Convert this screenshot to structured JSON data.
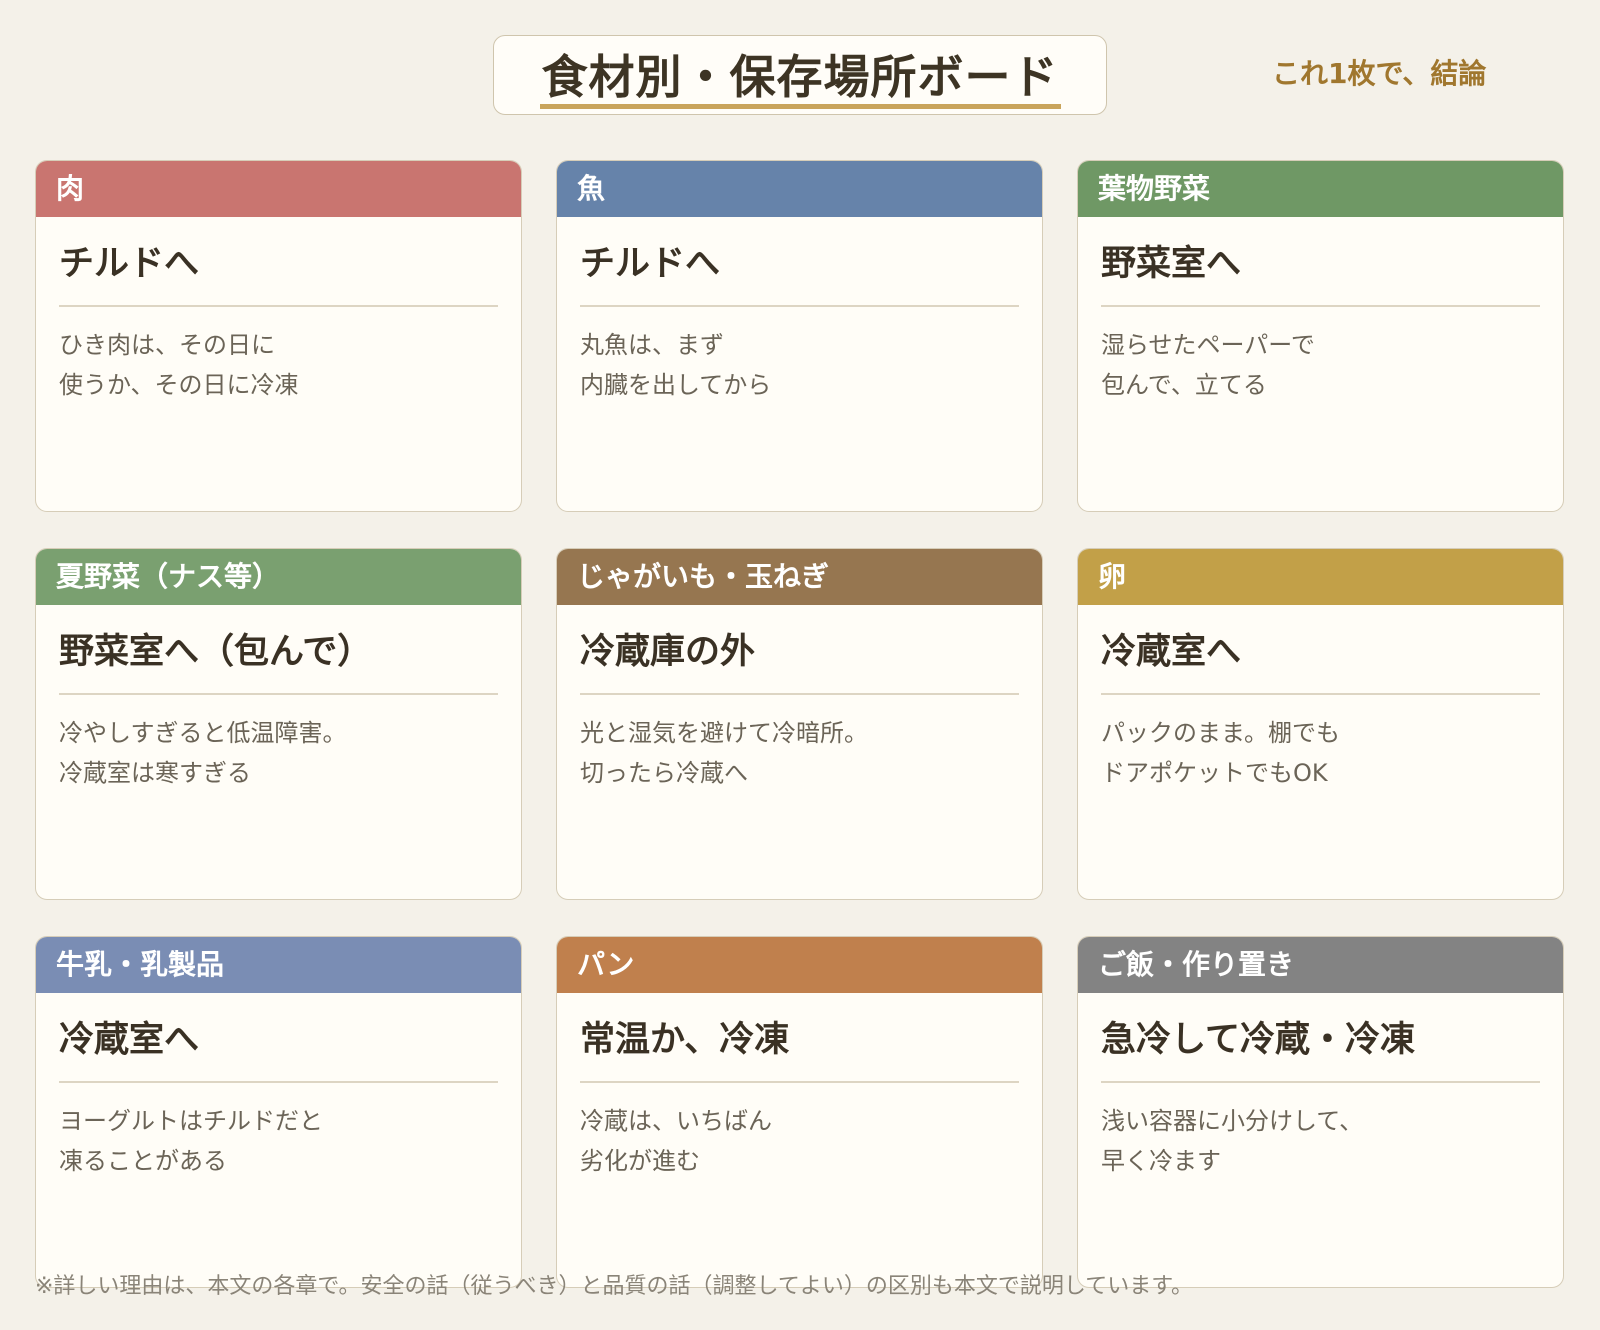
{
  "header": {
    "title": "食材別・保存場所ボード",
    "tagline": "これ1枚で、結論"
  },
  "cards": [
    {
      "category": "肉",
      "header_color": "#c97570",
      "location": "チルドへ",
      "note_lines": [
        "ひき肉は、その日に",
        "使うか、その日に冷凍"
      ]
    },
    {
      "category": "魚",
      "header_color": "#6683aa",
      "location": "チルドへ",
      "note_lines": [
        "丸魚は、まず",
        "内臓を出してから"
      ]
    },
    {
      "category": "葉物野菜",
      "header_color": "#6f9865",
      "location": "野菜室へ",
      "note_lines": [
        "湿らせたペーパーで",
        "包んで、立てる"
      ]
    },
    {
      "category": "夏野菜（ナス等）",
      "header_color": "#7aa070",
      "location": "野菜室へ（包んで）",
      "note_lines": [
        "冷やしすぎると低温障害。",
        "冷蔵室は寒すぎる"
      ]
    },
    {
      "category": "じゃがいも・玉ねぎ",
      "header_color": "#967650",
      "location": "冷蔵庫の外",
      "note_lines": [
        "光と湿気を避けて冷暗所。",
        "切ったら冷蔵へ"
      ]
    },
    {
      "category": "卵",
      "header_color": "#c2a048",
      "location": "冷蔵室へ",
      "note_lines": [
        "パックのまま。棚でも",
        "ドアポケットでもOK"
      ]
    },
    {
      "category": "牛乳・乳製品",
      "header_color": "#7a8db4",
      "location": "冷蔵室へ",
      "note_lines": [
        "ヨーグルトはチルドだと",
        "凍ることがある"
      ]
    },
    {
      "category": "パン",
      "header_color": "#c0804d",
      "location": "常温か、冷凍",
      "note_lines": [
        "冷蔵は、いちばん",
        "劣化が進む"
      ]
    },
    {
      "category": "ご飯・作り置き",
      "header_color": "#838383",
      "location": "急冷して冷蔵・冷凍",
      "note_lines": [
        "浅い容器に小分けして、",
        "早く冷ます"
      ]
    }
  ],
  "footnote": "※詳しい理由は、本文の各章で。安全の話（従うべき）と品質の話（調整してよい）の区別も本文で説明しています。"
}
